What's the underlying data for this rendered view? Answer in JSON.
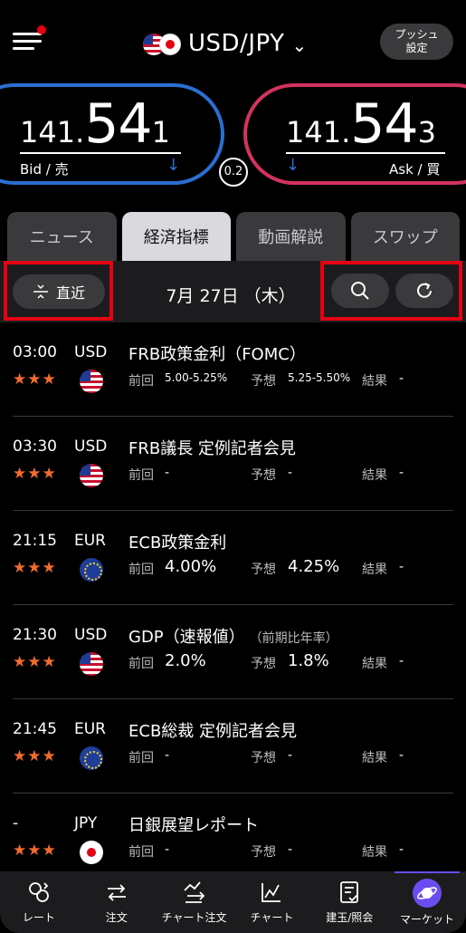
{
  "header": {
    "pair_label": "USD/JPY",
    "push_line1": "プッシュ",
    "push_line2": "設定"
  },
  "bid": {
    "price_small": "141.",
    "price_big": "54",
    "price_last": "1",
    "label": "Bid / 売"
  },
  "ask": {
    "price_small": "141.",
    "price_big": "54",
    "price_last": "3",
    "label": "Ask / 買"
  },
  "spread": "0.2",
  "tabs": [
    {
      "label": "ニュース",
      "active": false
    },
    {
      "label": "経済指標",
      "active": true
    },
    {
      "label": "動画解説",
      "active": false
    },
    {
      "label": "スワップ",
      "active": false
    }
  ],
  "toolbar": {
    "recent_label": "直近",
    "date_label": "7月 27日 （木）"
  },
  "events": [
    {
      "time": "03:00",
      "currency": "USD",
      "title": "FRB政策金利（FOMC）",
      "subtitle": "",
      "stars": "★★★",
      "flag": "us",
      "prev_label": "前回",
      "prev": "5.00-5.25%",
      "fcst_label": "予想",
      "fcst": "5.25-5.50%",
      "result_label": "結果",
      "result": "-"
    },
    {
      "time": "03:30",
      "currency": "USD",
      "title": "FRB議長 定例記者会見",
      "subtitle": "",
      "stars": "★★★",
      "flag": "us",
      "prev_label": "前回",
      "prev": "-",
      "fcst_label": "予想",
      "fcst": "-",
      "result_label": "結果",
      "result": "-"
    },
    {
      "time": "21:15",
      "currency": "EUR",
      "title": "ECB政策金利",
      "subtitle": "",
      "stars": "★★★",
      "flag": "eu",
      "prev_label": "前回",
      "prev": "4.00%",
      "fcst_label": "予想",
      "fcst": "4.25%",
      "result_label": "結果",
      "result": "-"
    },
    {
      "time": "21:30",
      "currency": "USD",
      "title": "GDP（速報値）",
      "subtitle": "（前期比年率）",
      "stars": "★★★",
      "flag": "us",
      "prev_label": "前回",
      "prev": "2.0%",
      "fcst_label": "予想",
      "fcst": "1.8%",
      "result_label": "結果",
      "result": "-"
    },
    {
      "time": "21:45",
      "currency": "EUR",
      "title": "ECB総裁 定例記者会見",
      "subtitle": "",
      "stars": "★★★",
      "flag": "eu",
      "prev_label": "前回",
      "prev": "-",
      "fcst_label": "予想",
      "fcst": "-",
      "result_label": "結果",
      "result": "-"
    },
    {
      "time": "-",
      "currency": "JPY",
      "title": "日銀展望レポート",
      "subtitle": "",
      "stars": "★★★",
      "flag": "jp",
      "prev_label": "前回",
      "prev": "-",
      "fcst_label": "予想",
      "fcst": "-",
      "result_label": "結果",
      "result": "-"
    }
  ],
  "bottom_nav": [
    {
      "label": "レート",
      "icon": "rate-icon"
    },
    {
      "label": "注文",
      "icon": "order-icon"
    },
    {
      "label": "チャート注文",
      "icon": "chart-order-icon"
    },
    {
      "label": "チャート",
      "icon": "chart-icon"
    },
    {
      "label": "建玉/照会",
      "icon": "positions-icon"
    },
    {
      "label": "マーケット",
      "icon": "market-icon",
      "active": true
    }
  ],
  "colors": {
    "bid": "#2a6fd1",
    "ask": "#d2335f",
    "stars": "#f26b2e",
    "highlight": "#e60012",
    "active_nav": "#6b4cf0"
  }
}
